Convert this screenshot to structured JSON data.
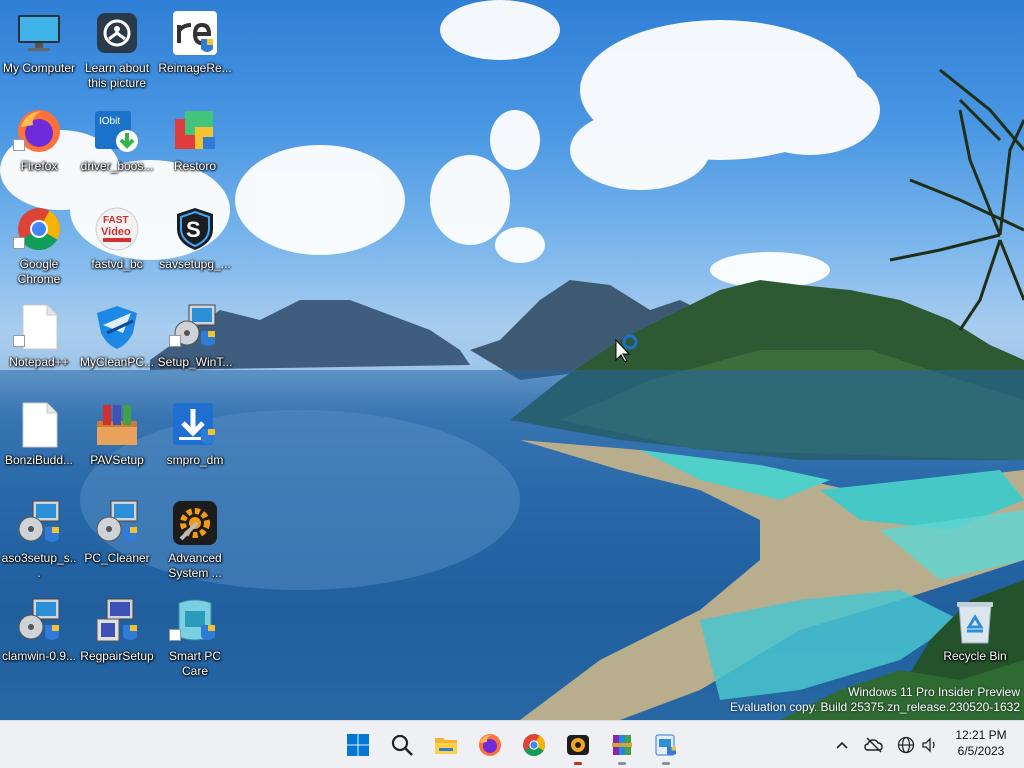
{
  "desktop_icons": [
    {
      "label": "My Computer",
      "icon": "monitor-icon"
    },
    {
      "label": "Learn about this picture",
      "icon": "camera-icon"
    },
    {
      "label": "ReimageRe...",
      "icon": "reimage-icon"
    },
    {
      "label": "Firefox",
      "icon": "firefox-icon"
    },
    {
      "label": "driver_boos...",
      "icon": "iobit-icon"
    },
    {
      "label": "Restoro",
      "icon": "restoro-icon"
    },
    {
      "label": "Google Chrome",
      "icon": "chrome-icon"
    },
    {
      "label": "fastvd_bc",
      "icon": "fast-video-icon"
    },
    {
      "label": "savsetupg_...",
      "icon": "shield-s-icon"
    },
    {
      "label": "Notepad++",
      "icon": "file-icon"
    },
    {
      "label": "MyCleanPC...",
      "icon": "mycleanpc-icon"
    },
    {
      "label": "Setup_WinT...",
      "icon": "setup-icon"
    },
    {
      "label": "BonziBudd...",
      "icon": "file-icon"
    },
    {
      "label": "PAVSetup",
      "icon": "box-icon"
    },
    {
      "label": "smpro_dm",
      "icon": "download-icon"
    },
    {
      "label": "aso3setup_s...",
      "icon": "setup-icon"
    },
    {
      "label": "PC_Cleaner",
      "icon": "setup-icon"
    },
    {
      "label": "Advanced System ...",
      "icon": "gear-icon"
    },
    {
      "label": "clamwin-0.9...",
      "icon": "setup-icon"
    },
    {
      "label": "RegpairSetup",
      "icon": "setup-icon"
    },
    {
      "label": "Smart PC Care",
      "icon": "smart-pc-icon"
    },
    {
      "label": "Recycle Bin",
      "icon": "recycle-bin-icon"
    }
  ],
  "watermark": {
    "line1": "Windows 11 Pro Insider Preview",
    "line2": "Evaluation copy. Build 25375.zn_release.230520-1632"
  },
  "taskbar": {
    "apps": [
      "start-icon",
      "search-icon",
      "file-explorer-icon",
      "firefox-icon",
      "chrome-icon",
      "media-app-icon",
      "winrar-icon",
      "installer-icon"
    ],
    "clock_time": "12:21 PM",
    "clock_date": "6/5/2023"
  },
  "colors": {
    "taskbar_bg": "#eef0f4",
    "start_blue": "#0078d4",
    "active_indicator": "#c42b1c"
  }
}
